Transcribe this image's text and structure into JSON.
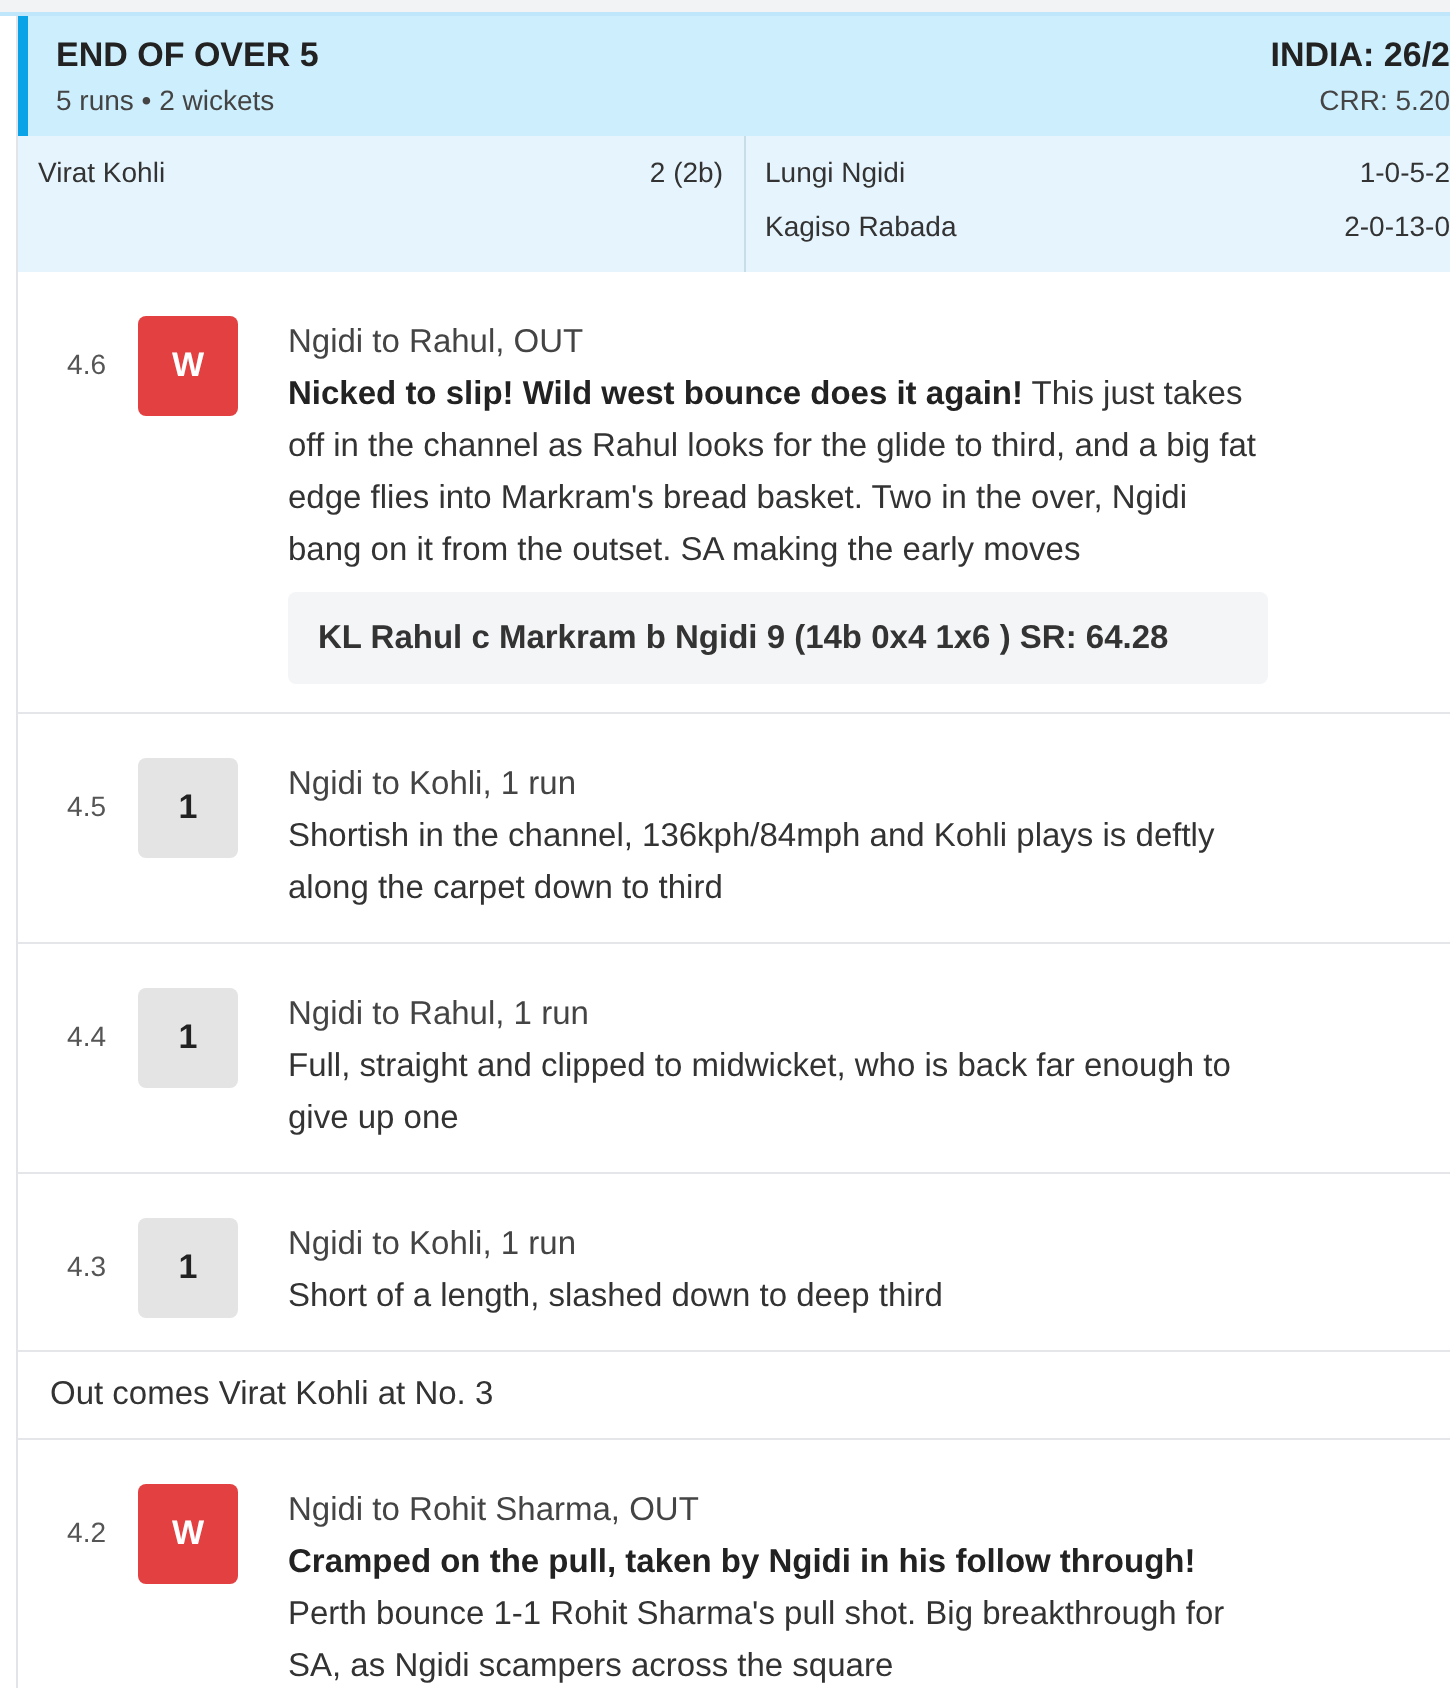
{
  "over_summary": {
    "title": "END OF OVER 5",
    "summary": "5 runs • 2 wickets",
    "score": "INDIA: 26/2",
    "crr": "CRR: 5.20",
    "batters": [
      {
        "name": "Virat Kohli",
        "stat": "2 (2b)"
      }
    ],
    "bowlers": [
      {
        "name": "Lungi Ngidi",
        "figures": "1-0-5-2"
      },
      {
        "name": "Kagiso Rabada",
        "figures": "2-0-13-0"
      }
    ]
  },
  "commentary": [
    {
      "kind": "ball",
      "over": "4.6",
      "result": "W",
      "wicket": true,
      "headline": "Ngidi to Rahul, OUT",
      "text": "**Nicked to slip! Wild west bounce does it again!** This just takes off in the channel as Rahul looks for the glide to third, and a big fat edge flies into Markram's bread basket. Two in the over, Ngidi bang on it from the outset. SA making the early moves",
      "dismissal": "KL Rahul c Markram b Ngidi 9 (14b 0x4 1x6 ) SR: 64.28"
    },
    {
      "kind": "ball",
      "over": "4.5",
      "result": "1",
      "wicket": false,
      "headline": "Ngidi to Kohli, 1 run",
      "text": "Shortish in the channel, 136kph/84mph and Kohli plays is deftly along the carpet down to third"
    },
    {
      "kind": "ball",
      "over": "4.4",
      "result": "1",
      "wicket": false,
      "headline": "Ngidi to Rahul, 1 run",
      "text": "Full, straight and clipped to midwicket, who is back far enough to give up one"
    },
    {
      "kind": "ball",
      "over": "4.3",
      "result": "1",
      "wicket": false,
      "headline": "Ngidi to Kohli, 1 run",
      "text": "Short of a length, slashed down to deep third"
    },
    {
      "kind": "note",
      "text": "Out comes Virat Kohli at No. 3"
    },
    {
      "kind": "ball",
      "over": "4.2",
      "result": "W",
      "wicket": true,
      "headline": "Ngidi to Rohit Sharma, OUT",
      "text": "**Cramped on the pull, taken by Ngidi in his follow through!** Perth bounce 1-1 Rohit Sharma's pull shot. Big breakthrough for SA, as Ngidi scampers across the square"
    }
  ]
}
